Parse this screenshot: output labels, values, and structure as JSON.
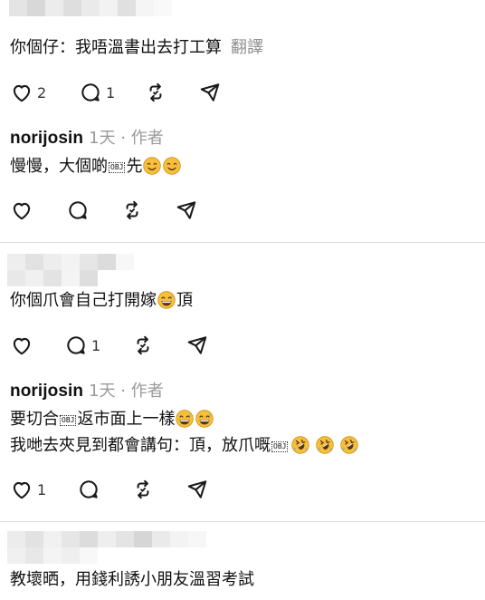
{
  "comments": [
    {
      "text": "你個仔：我唔溫書出去打工算",
      "translate_label": "翻譯",
      "likes": "2",
      "replies": "1"
    },
    {
      "author": "norijosin",
      "meta": "1天 · 作者",
      "text_before": "慢慢，大個啲",
      "obj_label": "OBJ",
      "text_after": "先"
    },
    {
      "text": "你個爪會自己打開嫁",
      "text_after": "頂",
      "replies": "1"
    },
    {
      "author": "norijosin",
      "meta": "1天 · 作者",
      "line1_before": "要切合",
      "line1_obj": "OBJ",
      "line1_after": "返市面上一樣",
      "line2_before": "我哋去夾見到都會講句：頂，放爪嘅",
      "line2_obj": "OBJ",
      "likes": "1"
    },
    {
      "text": "教壞晒，用錢利誘小朋友溫習考試"
    }
  ],
  "icons": {
    "like": "heart-icon",
    "reply": "comment-icon",
    "repost": "repost-icon",
    "share": "send-icon",
    "smile": "smiling-face-emoji",
    "grin_sweat": "grinning-sweat-emoji",
    "rofl": "rolling-laughing-emoji"
  },
  "colors": {
    "text": "#111111",
    "meta": "#9a9a9a",
    "divider": "#dcdcdc",
    "emoji_yellow": "#f7c03a"
  }
}
